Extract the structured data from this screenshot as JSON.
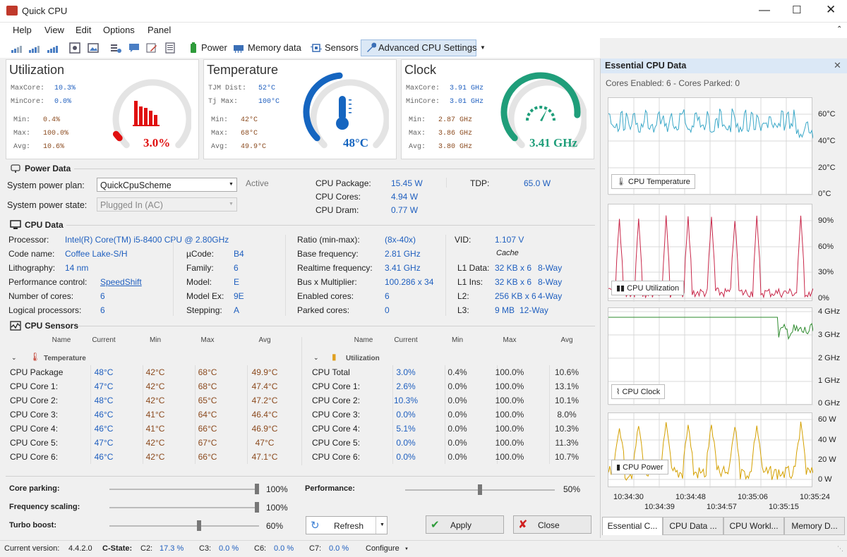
{
  "app": {
    "title": "Quick CPU"
  },
  "menu": [
    "Help",
    "View",
    "Edit",
    "Options",
    "Panel"
  ],
  "toolbar": {
    "power": "Power",
    "memory": "Memory data",
    "sensors": "Sensors",
    "advanced": "Advanced CPU Settings"
  },
  "util": {
    "title": "Utilization",
    "max_core_l": "MaxCore:",
    "max_core": "10.3%",
    "min_core_l": "MinCore:",
    "min_core": "0.0%",
    "min_l": "Min:",
    "min": "0.4%",
    "max_l": "Max:",
    "max": "100.0%",
    "avg_l": "Avg:",
    "avg": "10.6%",
    "value": "3.0%",
    "level": 0.03
  },
  "temp": {
    "title": "Temperature",
    "tjm_l": "TJM Dist:",
    "tjm": "52°C",
    "tjmax_l": "Tj Max:",
    "tjmax": "100°C",
    "min_l": "Min:",
    "min": "42°C",
    "max_l": "Max:",
    "max": "68°C",
    "avg_l": "Avg:",
    "avg": "49.9°C",
    "value": "48°C",
    "level": 0.48
  },
  "clock": {
    "title": "Clock",
    "max_core_l": "MaxCore:",
    "max_core": "3.91 GHz",
    "min_core_l": "MinCore:",
    "min_core": "3.01 GHz",
    "min_l": "Min:",
    "min": "2.87 GHz",
    "max_l": "Max:",
    "max": "3.86 GHz",
    "avg_l": "Avg:",
    "avg": "3.80 GHz",
    "value": "3.41 GHz",
    "level": 0.85
  },
  "power": {
    "section": "Power Data",
    "plan_l": "System power plan:",
    "plan": "QuickCpuScheme",
    "active": "Active",
    "state_l": "System power state:",
    "state": "Plugged In (AC)",
    "pkg_l": "CPU Package:",
    "pkg": "15.45 W",
    "cores_l": "CPU Cores:",
    "cores": "4.94 W",
    "dram_l": "CPU Dram:",
    "dram": "0.77 W",
    "tdp_l": "TDP:",
    "tdp": "65.0 W"
  },
  "cpu": {
    "section": "CPU Data",
    "c1": [
      [
        "Processor:",
        "Intel(R) Core(TM) i5-8400 CPU @ 2.80GHz"
      ],
      [
        "Code name:",
        "Coffee Lake-S/H"
      ],
      [
        "Lithography:",
        "14 nm"
      ],
      [
        "Performance control:",
        "SpeedShift"
      ],
      [
        "Number of cores:",
        "6"
      ],
      [
        "Logical processors:",
        "6"
      ]
    ],
    "c2": [
      [
        "µCode:",
        "B4"
      ],
      [
        "Family:",
        "6"
      ],
      [
        "Model:",
        "E"
      ],
      [
        "Model Ex:",
        "9E"
      ],
      [
        "Stepping:",
        "A"
      ]
    ],
    "c3": [
      [
        "Ratio (min-max):",
        "(8x-40x)"
      ],
      [
        "Base frequency:",
        "2.81 GHz"
      ],
      [
        "Realtime frequency:",
        "3.41 GHz"
      ],
      [
        "Bus x Multiplier:",
        "100.286 x 34"
      ],
      [
        "Enabled cores:",
        "6"
      ],
      [
        "Parked cores:",
        "0"
      ]
    ],
    "vid_l": "VID:",
    "vid": "1.107 V",
    "cache": "Cache",
    "c4": [
      [
        "L1 Data:",
        "32 KB x 6",
        "8-Way"
      ],
      [
        "L1 Ins:",
        "32 KB x 6",
        "8-Way"
      ],
      [
        "L2:",
        "256 KB x 6",
        "4-Way"
      ],
      [
        "L3:",
        "9 MB",
        "12-Way"
      ]
    ]
  },
  "sensors": {
    "section": "CPU Sensors",
    "headers": [
      "Name",
      "Current",
      "Min",
      "Max",
      "Avg"
    ],
    "temp_group": "Temperature",
    "util_group": "Utilization",
    "temp_rows": [
      [
        "CPU Package",
        "48°C",
        "42°C",
        "68°C",
        "49.9°C"
      ],
      [
        "CPU Core 1:",
        "47°C",
        "42°C",
        "68°C",
        "47.4°C"
      ],
      [
        "CPU Core 2:",
        "48°C",
        "42°C",
        "65°C",
        "47.2°C"
      ],
      [
        "CPU Core 3:",
        "46°C",
        "41°C",
        "64°C",
        "46.4°C"
      ],
      [
        "CPU Core 4:",
        "46°C",
        "41°C",
        "66°C",
        "46.9°C"
      ],
      [
        "CPU Core 5:",
        "47°C",
        "42°C",
        "67°C",
        "47°C"
      ],
      [
        "CPU Core 6:",
        "46°C",
        "42°C",
        "66°C",
        "47.1°C"
      ]
    ],
    "util_rows": [
      [
        "CPU Total",
        "3.0%",
        "0.4%",
        "100.0%",
        "10.6%"
      ],
      [
        "CPU Core 1:",
        "2.6%",
        "0.0%",
        "100.0%",
        "13.1%"
      ],
      [
        "CPU Core 2:",
        "10.3%",
        "0.0%",
        "100.0%",
        "10.1%"
      ],
      [
        "CPU Core 3:",
        "0.0%",
        "0.0%",
        "100.0%",
        "8.0%"
      ],
      [
        "CPU Core 4:",
        "5.1%",
        "0.0%",
        "100.0%",
        "10.3%"
      ],
      [
        "CPU Core 5:",
        "0.0%",
        "0.0%",
        "100.0%",
        "11.3%"
      ],
      [
        "CPU Core 6:",
        "0.0%",
        "0.0%",
        "100.0%",
        "10.7%"
      ]
    ]
  },
  "sliders": {
    "parking_l": "Core parking:",
    "parking": "100%",
    "parking_v": 1.0,
    "freq_l": "Frequency scaling:",
    "freq": "100%",
    "freq_v": 1.0,
    "turbo_l": "Turbo boost:",
    "turbo": "60%",
    "turbo_v": 0.6,
    "perf_l": "Performance:",
    "perf": "50%",
    "perf_v": 0.5
  },
  "buttons": {
    "refresh": "Refresh",
    "apply": "Apply",
    "close": "Close"
  },
  "status": {
    "version_l": "Current version:",
    "version": "4.4.2.0",
    "cstate_l": "C-State:",
    "c2_l": "C2:",
    "c2": "17.3 %",
    "c3_l": "C3:",
    "c3": "0.0 %",
    "c6_l": "C6:",
    "c6": "0.0 %",
    "c7_l": "C7:",
    "c7": "0.0 %",
    "configure": "Configure"
  },
  "right": {
    "title": "Essential CPU Data",
    "cores": "Cores Enabled: 6 - Cores Parked: 0",
    "g_temp": {
      "label": "CPU Temperature",
      "ticks": [
        "60°C",
        "40°C",
        "20°C",
        "0°C"
      ]
    },
    "g_util": {
      "label": "CPU Utilization",
      "ticks": [
        "90%",
        "60%",
        "30%",
        "0%"
      ]
    },
    "g_clock": {
      "label": "CPU Clock",
      "ticks": [
        "4 GHz",
        "3 GHz",
        "2 GHz",
        "1 GHz",
        "0 GHz"
      ]
    },
    "g_power": {
      "label": "CPU Power",
      "ticks": [
        "60 W",
        "40 W",
        "20 W",
        "0 W"
      ]
    },
    "times_top": [
      "10:34:30",
      "10:34:48",
      "10:35:06",
      "10:35:24"
    ],
    "times_bottom": [
      "10:34:39",
      "10:34:57",
      "10:35:15"
    ],
    "tabs": [
      "Essential C...",
      "CPU Data ...",
      "CPU Workl...",
      "Memory D..."
    ]
  },
  "colors": {
    "accent_blue": "#1f5fbf",
    "temp_gauge": "#1565c0",
    "util_gauge": "#e01010",
    "clock_gauge": "#1f9e7a",
    "graph_temp": "#3aa8c8",
    "graph_util": "#c8284a",
    "graph_clock": "#2e8b2e",
    "graph_power": "#d4a000"
  }
}
